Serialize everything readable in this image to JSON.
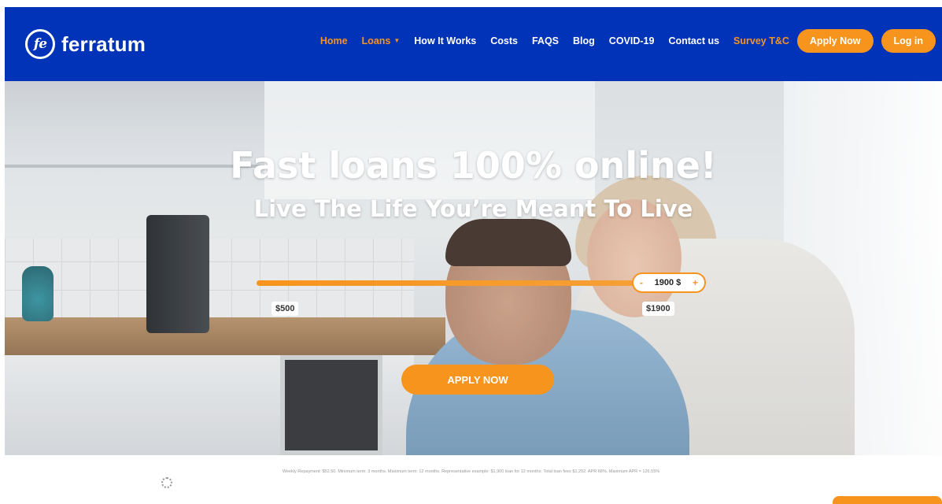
{
  "brand": {
    "logo_mark": "fe",
    "name": "ferratum"
  },
  "nav": {
    "home": "Home",
    "loans": "Loans",
    "how_it_works": "How It Works",
    "costs": "Costs",
    "faqs": "FAQS",
    "blog": "Blog",
    "covid": "COVID-19",
    "contact": "Contact us",
    "survey": "Survey T&C",
    "apply_now": "Apply Now",
    "login": "Log in"
  },
  "hero": {
    "title": "Fast loans 100% online!",
    "subtitle": "Live The Life You’re Meant To Live"
  },
  "calculator": {
    "min_label": "$500",
    "max_label": "$1900",
    "value_label": "1900 $",
    "value": 1900,
    "min": 500,
    "max": 1900,
    "decrement": "-",
    "increment": "+",
    "cta": "APPLY NOW"
  },
  "disclaimer": "Weekly Repayment: $52.50. Minimum term: 3 months. Maximum term: 12 months. Representative example: $1,900 loan for 12 months. Total loan fees $1,292. APR 68%. Maximum APR = 126.55%",
  "colors": {
    "header_blue": "#0033b8",
    "accent_orange": "#f7941d"
  }
}
